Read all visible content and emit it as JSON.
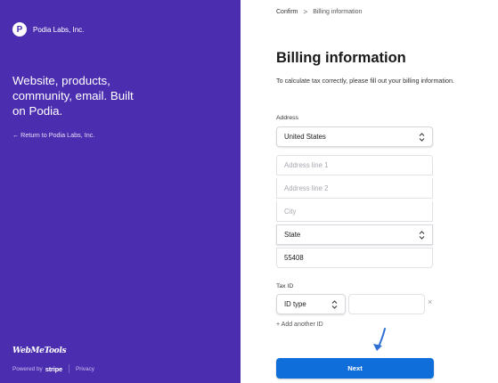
{
  "brand": {
    "logo_letter": "P",
    "name": "Podia Labs, Inc."
  },
  "left_panel": {
    "headline": "Website, products, community, email. Built on Podia.",
    "return_link": "← Return to Podia Labs, Inc.",
    "watermark": "WebMeTools",
    "powered_by": "Powered by",
    "stripe": "stripe",
    "privacy": "Privacy",
    "background_color": "#4b2db0"
  },
  "breadcrumb": {
    "confirm": "Confirm",
    "separator": ">",
    "current": "Billing information"
  },
  "page": {
    "title": "Billing information",
    "subtitle": "To calculate tax correctly, please fill out your billing information."
  },
  "address": {
    "label": "Address",
    "country": "United States",
    "line1_placeholder": "Address line 1",
    "line2_placeholder": "Address line 2",
    "city_placeholder": "City",
    "state": "State",
    "zip": "55408"
  },
  "tax_id": {
    "label": "Tax ID",
    "id_type": "ID type",
    "clear_icon": "×",
    "add_another": "+ Add another ID"
  },
  "next_button": {
    "label": "Next",
    "color": "#0f6ed9"
  }
}
